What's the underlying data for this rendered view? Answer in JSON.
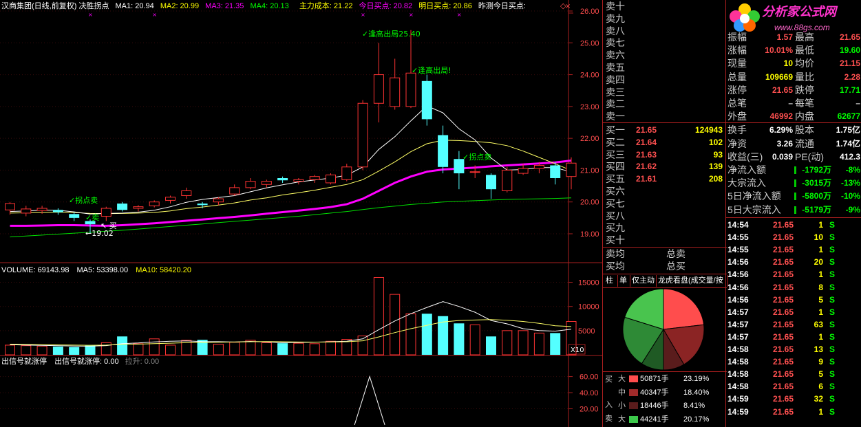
{
  "header": {
    "title": "汉商集团(日线,前复权) 决胜拐点",
    "ma1_label": "MA1: 20.94",
    "ma2_label": "MA2: 20.99",
    "ma3_label": "MA3: 21.35",
    "ma4_label": "MA4: 20.13",
    "cost_label": "主力成本: 21.22",
    "today_buy_label": "今日买点: 20.82",
    "tomorrow_buy_label": "明日买点: 20.86",
    "yesterday_label": "昨测今日买点:",
    "colors": {
      "ma1": "#ffffff",
      "ma2": "#ffff00",
      "ma3": "#ff00ff",
      "ma4": "#00ff00",
      "cost": "#ffff00",
      "today": "#ff00ff",
      "tomorrow": "#ffff00"
    }
  },
  "price_axis": {
    "labels": [
      "26.00",
      "25.00",
      "24.00",
      "23.00",
      "22.00",
      "21.00",
      "20.00",
      "19.00"
    ]
  },
  "annotations": {
    "sell_high_1": "✓逢高出局25.40",
    "sell_high_2": "✓逢高出局!",
    "turn_sell_1": "✓拐点卖",
    "turn_sell_2": "✓拐点卖",
    "sell_small": "✓卖",
    "buy_small": "↖ 买",
    "low_label": "←19.02"
  },
  "volume_header": {
    "volume_label": "VOLUME: 69143.98",
    "ma5_label": "MA5: 53398.00",
    "ma10_label": "MA10: 58420.20"
  },
  "volume_axis": {
    "labels": [
      "15000",
      "10000",
      "5000"
    ],
    "unit": "X10"
  },
  "signal_header": {
    "title": "出信号就涨停",
    "value_label": "出信号就涨停: 0.00",
    "rise_label": "拉升: 0.00"
  },
  "signal_axis": {
    "labels": [
      "60.00",
      "40.00",
      "20.00"
    ]
  },
  "chart_data": {
    "type": "candlestick",
    "candles": [
      {
        "o": 19.75,
        "c": 19.95,
        "h": 20.0,
        "l": 19.6,
        "v": 2000
      },
      {
        "o": 19.65,
        "c": 19.78,
        "h": 19.88,
        "l": 19.55,
        "v": 1900
      },
      {
        "o": 19.73,
        "c": 19.8,
        "h": 19.88,
        "l": 19.63,
        "v": 1800
      },
      {
        "o": 19.75,
        "c": 19.68,
        "h": 19.8,
        "l": 19.6,
        "v": 1700
      },
      {
        "o": 19.62,
        "c": 19.5,
        "h": 19.68,
        "l": 19.4,
        "v": 1600
      },
      {
        "o": 19.4,
        "c": 19.3,
        "h": 19.45,
        "l": 19.02,
        "v": 1900
      },
      {
        "o": 19.55,
        "c": 19.8,
        "h": 19.85,
        "l": 19.4,
        "v": 2500
      },
      {
        "o": 19.95,
        "c": 19.75,
        "h": 20.0,
        "l": 19.7,
        "v": 3800
      },
      {
        "o": 19.8,
        "c": 19.85,
        "h": 19.9,
        "l": 19.7,
        "v": 2300
      },
      {
        "o": 19.88,
        "c": 20.0,
        "h": 20.05,
        "l": 19.83,
        "v": 3300
      },
      {
        "o": 20.05,
        "c": 20.15,
        "h": 20.2,
        "l": 19.95,
        "v": 2000
      },
      {
        "o": 20.2,
        "c": 20.35,
        "h": 20.45,
        "l": 20.1,
        "v": 3000
      },
      {
        "o": 19.95,
        "c": 19.9,
        "h": 20.0,
        "l": 19.8,
        "v": 3100
      },
      {
        "o": 20.0,
        "c": 20.1,
        "h": 20.15,
        "l": 19.9,
        "v": 2200
      },
      {
        "o": 20.25,
        "c": 20.45,
        "h": 20.55,
        "l": 20.2,
        "v": 2600
      },
      {
        "o": 20.45,
        "c": 20.65,
        "h": 20.75,
        "l": 20.4,
        "v": 3000
      },
      {
        "o": 20.55,
        "c": 20.65,
        "h": 20.7,
        "l": 20.45,
        "v": 2500
      },
      {
        "o": 20.75,
        "c": 20.68,
        "h": 20.8,
        "l": 20.6,
        "v": 2400
      },
      {
        "o": 20.65,
        "c": 20.7,
        "h": 20.75,
        "l": 20.55,
        "v": 2400
      },
      {
        "o": 20.7,
        "c": 20.8,
        "h": 20.85,
        "l": 20.6,
        "v": 2300
      },
      {
        "o": 20.6,
        "c": 20.85,
        "h": 20.9,
        "l": 20.55,
        "v": 2800
      },
      {
        "o": 20.7,
        "c": 21.1,
        "h": 21.2,
        "l": 20.65,
        "v": 3200
      },
      {
        "o": 21.1,
        "c": 23.1,
        "h": 23.2,
        "l": 21.0,
        "v": 3900
      },
      {
        "o": 23.1,
        "c": 24.0,
        "h": 25.0,
        "l": 22.5,
        "v": 16000
      },
      {
        "o": 23.0,
        "c": 23.9,
        "h": 24.5,
        "l": 22.9,
        "v": 12500
      },
      {
        "o": 23.0,
        "c": 24.05,
        "h": 25.4,
        "l": 22.95,
        "v": 8500
      },
      {
        "o": 23.8,
        "c": 22.6,
        "h": 24.0,
        "l": 22.4,
        "v": 8500
      },
      {
        "o": 22.1,
        "c": 21.1,
        "h": 22.4,
        "l": 20.9,
        "v": 8000
      },
      {
        "o": 21.35,
        "c": 20.9,
        "h": 21.6,
        "l": 20.4,
        "v": 6500
      },
      {
        "o": 20.95,
        "c": 20.95,
        "h": 21.15,
        "l": 20.75,
        "v": 6200
      },
      {
        "o": 20.85,
        "c": 20.4,
        "h": 20.9,
        "l": 20.1,
        "v": 3800
      },
      {
        "o": 20.35,
        "c": 21.0,
        "h": 21.1,
        "l": 20.3,
        "v": 5000
      },
      {
        "o": 20.9,
        "c": 21.05,
        "h": 21.2,
        "l": 20.85,
        "v": 5000
      },
      {
        "o": 21.05,
        "c": 21.15,
        "h": 21.25,
        "l": 20.9,
        "v": 4500
      },
      {
        "o": 21.15,
        "c": 20.75,
        "h": 21.25,
        "l": 20.55,
        "v": 4500
      },
      {
        "o": 20.8,
        "c": 21.22,
        "h": 21.4,
        "l": 20.4,
        "v": 6900
      }
    ],
    "ma_fast": [
      19.7,
      19.72,
      19.74,
      19.74,
      19.69,
      19.62,
      19.64,
      19.65,
      19.68,
      19.74,
      19.85,
      19.99,
      20.08,
      20.14,
      20.2,
      20.32,
      20.44,
      20.54,
      20.63,
      20.69,
      20.75,
      20.84,
      21.1,
      21.65,
      22.05,
      22.55,
      23.02,
      22.8,
      22.3,
      21.95,
      21.38,
      21.0,
      21.02,
      21.08,
      21.08,
      20.94
    ],
    "ma_mid": [
      19.65,
      19.66,
      19.67,
      19.68,
      19.67,
      19.64,
      19.63,
      19.64,
      19.65,
      19.67,
      19.72,
      19.79,
      19.84,
      19.9,
      19.97,
      20.06,
      20.13,
      20.22,
      20.29,
      20.37,
      20.46,
      20.55,
      20.7,
      20.97,
      21.26,
      21.58,
      21.83,
      21.94,
      21.93,
      21.9,
      21.86,
      21.77,
      21.6,
      21.4,
      21.2,
      20.99
    ],
    "ma_cost": [
      19.25,
      19.25,
      19.26,
      19.27,
      19.27,
      19.26,
      19.25,
      19.27,
      19.3,
      19.33,
      19.37,
      19.41,
      19.45,
      19.49,
      19.53,
      19.58,
      19.63,
      19.68,
      19.73,
      19.78,
      19.84,
      19.93,
      20.1,
      20.35,
      20.6,
      20.8,
      20.95,
      21.02,
      21.05,
      21.08,
      21.12,
      21.15,
      21.18,
      21.21,
      21.24,
      21.3
    ],
    "ma_long": [
      18.9,
      18.93,
      18.96,
      18.99,
      19.02,
      19.05,
      19.08,
      19.11,
      19.15,
      19.19,
      19.23,
      19.27,
      19.31,
      19.35,
      19.39,
      19.43,
      19.47,
      19.51,
      19.55,
      19.6,
      19.65,
      19.7,
      19.76,
      19.82,
      19.87,
      19.92,
      19.96,
      20.0,
      20.02,
      20.04,
      20.06,
      20.08,
      20.09,
      20.1,
      20.11,
      20.13
    ],
    "vol_ma5": [
      2100,
      2000,
      1950,
      1880,
      1800,
      1780,
      1900,
      2300,
      2440,
      2680,
      2800,
      2880,
      2740,
      2720,
      2640,
      2780,
      2660,
      2500,
      2560,
      2620,
      2700,
      2820,
      3300,
      5200,
      7000,
      8500,
      9800,
      11000,
      10000,
      8800,
      7100,
      6400,
      5400,
      5000,
      4900,
      5300
    ],
    "vol_ma10": [
      2200,
      2150,
      2100,
      2050,
      2000,
      1980,
      2000,
      2150,
      2200,
      2300,
      2400,
      2500,
      2550,
      2600,
      2640,
      2700,
      2750,
      2700,
      2650,
      2630,
      2650,
      2700,
      2900,
      3700,
      4600,
      5400,
      6100,
      6800,
      7100,
      7200,
      7300,
      7150,
      6900,
      6500,
      6000,
      5842
    ],
    "signal": {
      "index": 22,
      "value": 60
    },
    "y_range": [
      18.45,
      26.25
    ],
    "vol_range": [
      0,
      16500
    ],
    "signal_range": [
      0,
      75
    ]
  },
  "right_panel": {
    "sell_labels": [
      "卖十",
      "卖九",
      "卖八",
      "卖七",
      "卖六",
      "卖五",
      "卖四",
      "卖三",
      "卖二",
      "卖一"
    ],
    "buy_rows": [
      {
        "label": "买一",
        "price": "21.65",
        "vol": "124943"
      },
      {
        "label": "买二",
        "price": "21.64",
        "vol": "102"
      },
      {
        "label": "买三",
        "price": "21.63",
        "vol": "93"
      },
      {
        "label": "买四",
        "price": "21.62",
        "vol": "139"
      },
      {
        "label": "买五",
        "price": "21.61",
        "vol": "208"
      },
      {
        "label": "买六",
        "price": "",
        "vol": ""
      },
      {
        "label": "买七",
        "price": "",
        "vol": ""
      },
      {
        "label": "买八",
        "price": "",
        "vol": ""
      },
      {
        "label": "买九",
        "price": "",
        "vol": ""
      },
      {
        "label": "买十",
        "price": "",
        "vol": ""
      }
    ],
    "avg_sell": "卖均",
    "avg_buy": "买均",
    "total_sell": "总卖",
    "total_buy": "总买",
    "tabs": [
      "柱",
      "单",
      "仅主动",
      "龙虎看盘(成交量/按"
    ],
    "pie_labels": {
      "buy": "买",
      "in": "入",
      "sell": "卖"
    },
    "pie_rows": [
      {
        "size": "大",
        "value": "50871手",
        "pct": "23.19%",
        "color": "#ff4d4d"
      },
      {
        "size": "中",
        "value": "40347手",
        "pct": "18.40%",
        "color": "#a02a2a"
      },
      {
        "size": "小",
        "value": "18446手",
        "pct": "8.41%",
        "color": "#5a1c1c"
      },
      {
        "size": "大",
        "value": "44241手",
        "pct": "20.17%",
        "color": "#3cc84b"
      }
    ],
    "pie_slices": [
      {
        "name": "buy-large",
        "pct": 23.19,
        "color": "#ff4d4d"
      },
      {
        "name": "buy-mid",
        "pct": 18.4,
        "color": "#8b2424"
      },
      {
        "name": "buy-small",
        "pct": 8.41,
        "color": "#5a1c1c"
      },
      {
        "name": "sell-small",
        "pct": 9.0,
        "color": "#1f5a24"
      },
      {
        "name": "sell-mid",
        "pct": 20.83,
        "color": "#2e8a36"
      },
      {
        "name": "sell-large",
        "pct": 20.17,
        "color": "#49c44e"
      }
    ]
  },
  "stats_panel": {
    "logo_text": "分析家公式网",
    "logo_sub": "www.88gs.com",
    "rows": [
      {
        "k1": "振幅",
        "v1": "1.57",
        "k2": "最高",
        "v2": "21.65",
        "c1": "#ff5050",
        "c2": "#ff5050"
      },
      {
        "k1": "涨幅",
        "v1": "10.01%",
        "k2": "最低",
        "v2": "19.60",
        "c1": "#ff5050",
        "c2": "#00ff00"
      },
      {
        "k1": "现量",
        "v1": "10",
        "k2": "均价",
        "v2": "21.15",
        "c1": "#ffff00",
        "c2": "#ff5050"
      },
      {
        "k1": "总量",
        "v1": "109669",
        "k2": "量比",
        "v2": "2.28",
        "c1": "#ffff00",
        "c2": "#ff5050"
      },
      {
        "k1": "涨停",
        "v1": "21.65",
        "k2": "跌停",
        "v2": "17.71",
        "c1": "#ff5050",
        "c2": "#00ff00"
      },
      {
        "k1": "总笔",
        "v1": "–",
        "k2": "每笔",
        "v2": "–",
        "c1": "#cccccc",
        "c2": "#cccccc"
      },
      {
        "k1": "外盘",
        "v1": "46992",
        "k2": "内盘",
        "v2": "62677",
        "c1": "#ff5050",
        "c2": "#00ff00"
      },
      {
        "k1": "换手",
        "v1": "6.29%",
        "k2": "股本",
        "v2": "1.75亿",
        "c1": "#ffffff",
        "c2": "#ffffff"
      },
      {
        "k1": "净资",
        "v1": "3.26",
        "k2": "流通",
        "v2": "1.74亿",
        "c1": "#ffffff",
        "c2": "#ffffff"
      },
      {
        "k1": "收益(三)",
        "v1": "0.039",
        "k2": "PE(动)",
        "v2": "412.3",
        "c1": "#ffffff",
        "c2": "#ffffff"
      }
    ],
    "flow_rows": [
      {
        "label": "净流入额",
        "value": "-1792万",
        "pct": "-8%"
      },
      {
        "label": "大宗流入",
        "value": "-3015万",
        "pct": "-13%"
      },
      {
        "label": "5日净流入额",
        "value": "-5800万",
        "pct": "-10%"
      },
      {
        "label": "5日大宗流入",
        "value": "-5179万",
        "pct": "-9%"
      }
    ]
  },
  "trades": [
    {
      "time": "14:54",
      "price": "21.65",
      "vol": "1",
      "side": "S"
    },
    {
      "time": "14:55",
      "price": "21.65",
      "vol": "10",
      "side": "S"
    },
    {
      "time": "14:55",
      "price": "21.65",
      "vol": "1",
      "side": "S"
    },
    {
      "time": "14:56",
      "price": "21.65",
      "vol": "20",
      "side": "S"
    },
    {
      "time": "14:56",
      "price": "21.65",
      "vol": "1",
      "side": "S"
    },
    {
      "time": "14:56",
      "price": "21.65",
      "vol": "8",
      "side": "S"
    },
    {
      "time": "14:56",
      "price": "21.65",
      "vol": "5",
      "side": "S"
    },
    {
      "time": "14:57",
      "price": "21.65",
      "vol": "1",
      "side": "S"
    },
    {
      "time": "14:57",
      "price": "21.65",
      "vol": "63",
      "side": "S"
    },
    {
      "time": "14:57",
      "price": "21.65",
      "vol": "1",
      "side": "S"
    },
    {
      "time": "14:58",
      "price": "21.65",
      "vol": "13",
      "side": "S"
    },
    {
      "time": "14:58",
      "price": "21.65",
      "vol": "9",
      "side": "S"
    },
    {
      "time": "14:58",
      "price": "21.65",
      "vol": "5",
      "side": "S"
    },
    {
      "time": "14:58",
      "price": "21.65",
      "vol": "6",
      "side": "S"
    },
    {
      "time": "14:59",
      "price": "21.65",
      "vol": "32",
      "side": "S"
    },
    {
      "time": "14:59",
      "price": "21.65",
      "vol": "1",
      "side": "S"
    }
  ]
}
